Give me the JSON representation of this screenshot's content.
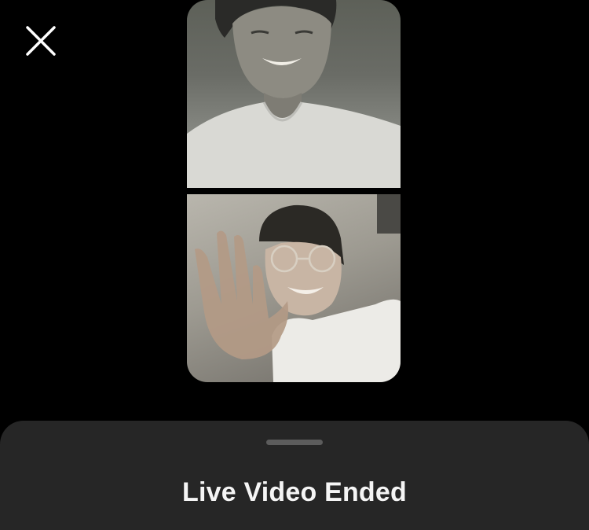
{
  "header": {
    "close_icon": "close-icon"
  },
  "video": {
    "participants": [
      {
        "name_icon": "person-video-feed"
      },
      {
        "name_icon": "person-video-feed"
      }
    ]
  },
  "sheet": {
    "title": "Live Video Ended"
  },
  "colors": {
    "background": "#000000",
    "sheet": "#262626",
    "grabber": "#5c5c5c",
    "title_text": "#f5f5f5"
  }
}
